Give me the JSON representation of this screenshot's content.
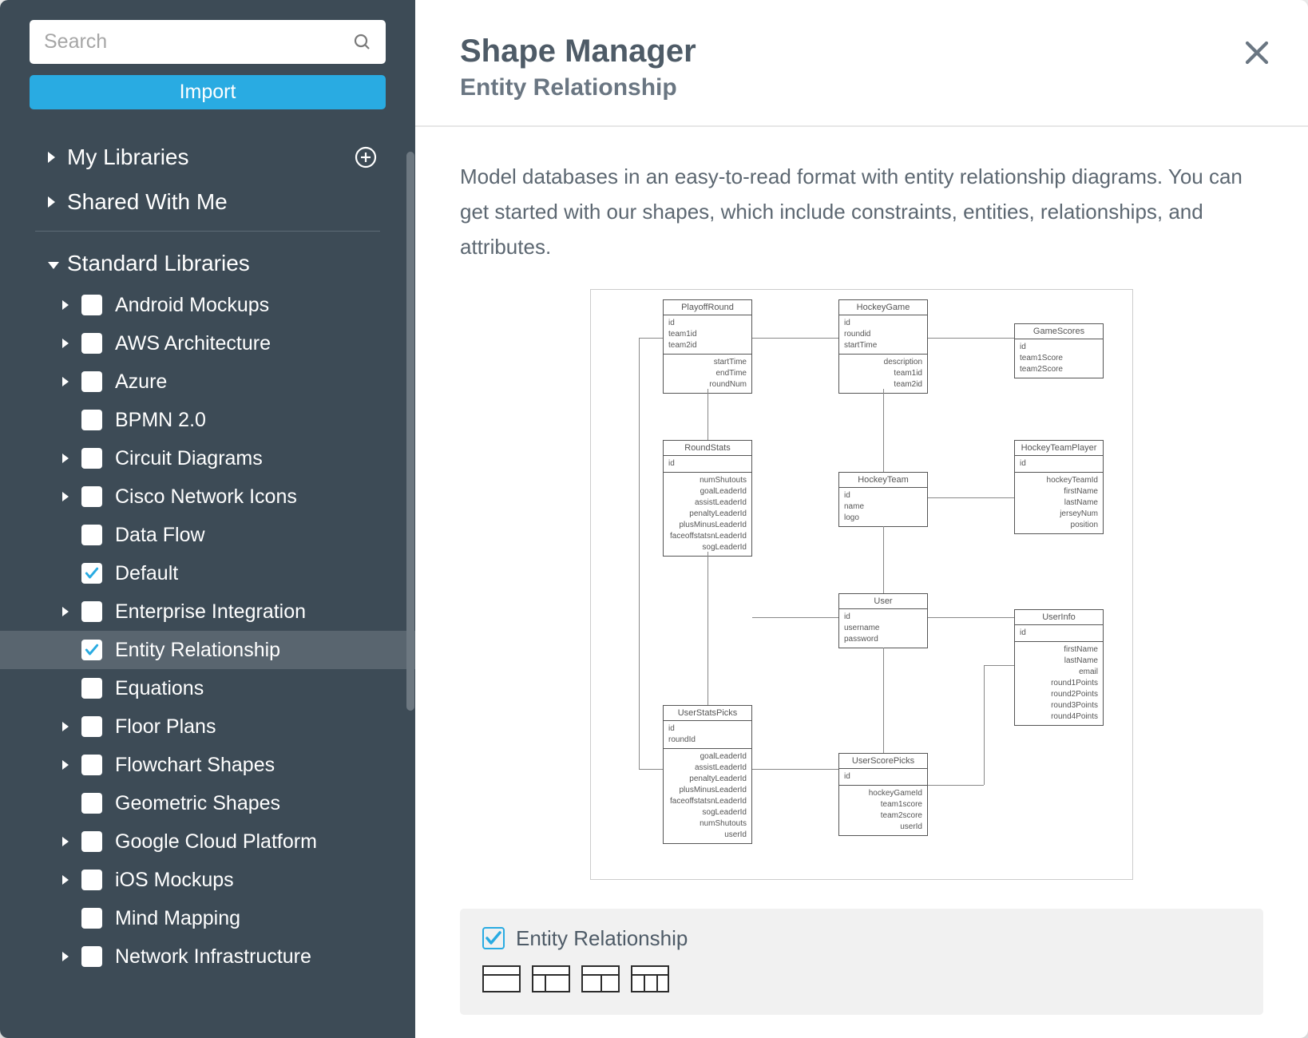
{
  "sidebar": {
    "search_placeholder": "Search",
    "import_label": "Import",
    "sections": {
      "my_libraries": "My Libraries",
      "shared_with_me": "Shared With Me",
      "standard_libraries": "Standard Libraries"
    },
    "items": [
      {
        "label": "Android Mockups",
        "checked": false,
        "expandable": true,
        "selected": false
      },
      {
        "label": "AWS Architecture",
        "checked": false,
        "expandable": true,
        "selected": false
      },
      {
        "label": "Azure",
        "checked": false,
        "expandable": true,
        "selected": false
      },
      {
        "label": "BPMN 2.0",
        "checked": false,
        "expandable": false,
        "selected": false
      },
      {
        "label": "Circuit Diagrams",
        "checked": false,
        "expandable": true,
        "selected": false
      },
      {
        "label": "Cisco Network Icons",
        "checked": false,
        "expandable": true,
        "selected": false
      },
      {
        "label": "Data Flow",
        "checked": false,
        "expandable": false,
        "selected": false
      },
      {
        "label": "Default",
        "checked": true,
        "expandable": false,
        "selected": false
      },
      {
        "label": "Enterprise Integration",
        "checked": false,
        "expandable": true,
        "selected": false
      },
      {
        "label": "Entity Relationship",
        "checked": true,
        "expandable": false,
        "selected": true
      },
      {
        "label": "Equations",
        "checked": false,
        "expandable": false,
        "selected": false
      },
      {
        "label": "Floor Plans",
        "checked": false,
        "expandable": true,
        "selected": false
      },
      {
        "label": "Flowchart Shapes",
        "checked": false,
        "expandable": true,
        "selected": false
      },
      {
        "label": "Geometric Shapes",
        "checked": false,
        "expandable": false,
        "selected": false
      },
      {
        "label": "Google Cloud Platform",
        "checked": false,
        "expandable": true,
        "selected": false
      },
      {
        "label": "iOS Mockups",
        "checked": false,
        "expandable": true,
        "selected": false
      },
      {
        "label": "Mind Mapping",
        "checked": false,
        "expandable": false,
        "selected": false
      },
      {
        "label": "Network Infrastructure",
        "checked": false,
        "expandable": true,
        "selected": false
      }
    ]
  },
  "main": {
    "title": "Shape Manager",
    "subtitle": "Entity Relationship",
    "description": "Model databases in an easy-to-read format with entity relationship diagrams. You can get started with our shapes, which include constraints, entities, relationships, and attributes.",
    "shape_card": {
      "title": "Entity Relationship",
      "checked": true
    }
  },
  "diagram": {
    "entities": [
      {
        "name": "PlayoffRound",
        "fields_top": "id\nteam1id\nteam2id",
        "fields": "startTime\nendTime\nroundNum"
      },
      {
        "name": "HockeyGame",
        "fields_top": "id\nroundid\nstartTime",
        "fields": "description\nteam1id\nteam2id"
      },
      {
        "name": "GameScores",
        "fields": "id\nteam1Score\nteam2Score"
      },
      {
        "name": "RoundStats",
        "fields_top": "id",
        "fields": "numShutouts\ngoalLeaderId\nassistLeaderId\npenaltyLeaderId\nplusMinusLeaderId\nfaceoffstatsnLeaderId\nsogLeaderId"
      },
      {
        "name": "HockeyTeam",
        "fields_top": "id\nname\nlogo",
        "fields": ""
      },
      {
        "name": "HockeyTeamPlayer",
        "fields_top": "id",
        "fields": "hockeyTeamId\nfirstName\nlastName\njerseyNum\nposition"
      },
      {
        "name": "User",
        "fields_top": "id\nusername\npassword",
        "fields": ""
      },
      {
        "name": "UserInfo",
        "fields_top": "id",
        "fields": "firstName\nlastName\nemail\nround1Points\nround2Points\nround3Points\nround4Points"
      },
      {
        "name": "UserStatsPicks",
        "fields_top": "id\nroundId",
        "fields": "goalLeaderId\nassistLeaderId\npenaltyLeaderId\nplusMinusLeaderId\nfaceoffstatsnLeaderId\nsogLeaderId\nnumShutouts\nuserId"
      },
      {
        "name": "UserScorePicks",
        "fields_top": "id",
        "fields": "hockeyGameId\nteam1score\nteam2score\nuserId"
      }
    ]
  }
}
